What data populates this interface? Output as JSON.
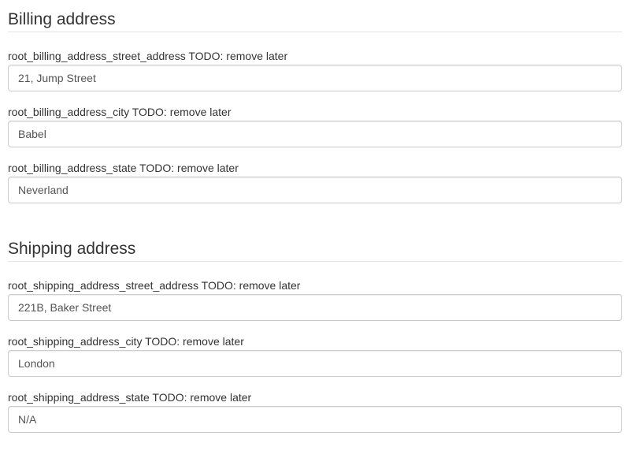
{
  "billing": {
    "title": "Billing address",
    "fields": [
      {
        "label": "root_billing_address_street_address TODO: remove later",
        "value": "21, Jump Street"
      },
      {
        "label": "root_billing_address_city TODO: remove later",
        "value": "Babel"
      },
      {
        "label": "root_billing_address_state TODO: remove later",
        "value": "Neverland"
      }
    ]
  },
  "shipping": {
    "title": "Shipping address",
    "fields": [
      {
        "label": "root_shipping_address_street_address TODO: remove later",
        "value": "221B, Baker Street"
      },
      {
        "label": "root_shipping_address_city TODO: remove later",
        "value": "London"
      },
      {
        "label": "root_shipping_address_state TODO: remove later",
        "value": "N/A"
      }
    ]
  }
}
